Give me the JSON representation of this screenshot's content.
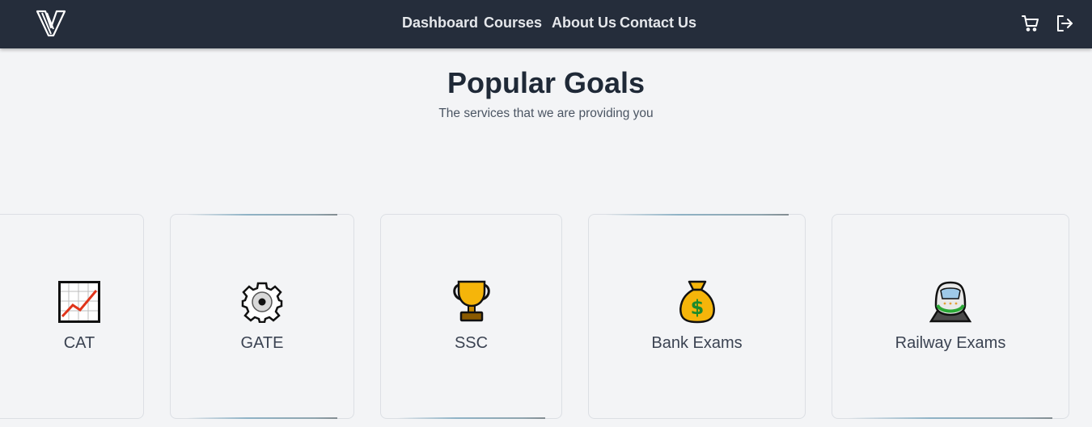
{
  "nav": {
    "links": [
      "Dashboard",
      "Courses",
      "About Us",
      "Contact Us"
    ],
    "icons": [
      "cart-icon",
      "logout-icon"
    ]
  },
  "hero": {
    "title": "Popular Goals",
    "subtitle": "The services that we are providing you"
  },
  "goals": [
    {
      "label": "CAT",
      "icon": "chart-increasing-icon"
    },
    {
      "label": "GATE",
      "icon": "gear-icon"
    },
    {
      "label": "SSC",
      "icon": "trophy-icon"
    },
    {
      "label": "Bank Exams",
      "icon": "money-bag-icon"
    },
    {
      "label": "Railway Exams",
      "icon": "train-icon"
    }
  ],
  "colors": {
    "navbar": "#252d3b",
    "background": "#f3f4f6",
    "heading": "#1f2937",
    "nav_text": "#e5e7eb"
  }
}
